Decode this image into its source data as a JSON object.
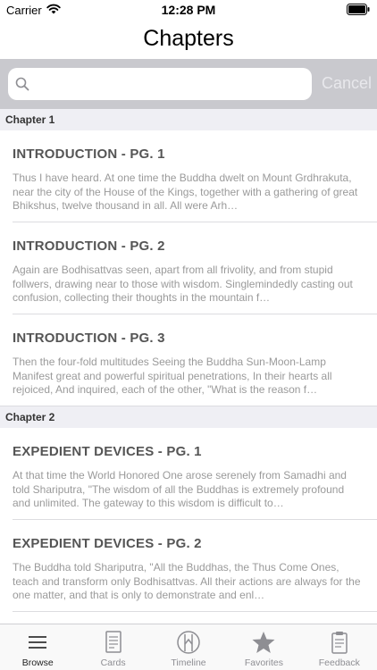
{
  "status": {
    "carrier": "Carrier",
    "time": "12:28 PM"
  },
  "nav": {
    "title": "Chapters"
  },
  "search": {
    "placeholder": "",
    "value": "",
    "cancel_label": "Cancel"
  },
  "sections": [
    {
      "header": "Chapter 1",
      "rows": [
        {
          "title": "INTRODUCTION - PG. 1",
          "excerpt": "Thus I have heard. At one time the Buddha dwelt on Mount Grdhrakuta, near the city of the House of the Kings, together with a gathering of great Bhikshus, twelve thousand in all. All were Arh…"
        },
        {
          "title": "INTRODUCTION - PG. 2",
          "excerpt": "Again are Bodhisattvas seen, apart from all frivolity, and from stupid follwers, drawing near to those with wisdom. Singlemindedly casting out confusion, collecting their thoughts in the mountain f…"
        },
        {
          "title": "INTRODUCTION - PG. 3",
          "excerpt": "Then the four-fold multitudes Seeing the Buddha Sun-Moon-Lamp Manifest great and powerful spiritual penetrations, In their hearts all rejoiced, And inquired, each of the other, \"What is the reason f…"
        }
      ]
    },
    {
      "header": "Chapter 2",
      "rows": [
        {
          "title": "EXPEDIENT DEVICES - PG. 1",
          "excerpt": "At that time the World Honored One arose serenely from Samadhi and told Shariputra, \"The wisdom of all the Buddhas is extremely profound and unlimited. The gateway to this wisdom is difficult to…"
        },
        {
          "title": "EXPEDIENT DEVICES - PG. 2",
          "excerpt": "The Buddha told Shariputra, \"All the Buddhas, the Thus Come Ones, teach and transform only Bodhisattvas. All their actions are always for the one matter, and that is only to demonstrate and enl…"
        }
      ]
    }
  ],
  "tabs": [
    {
      "label": "Browse",
      "icon": "list-icon",
      "active": true
    },
    {
      "label": "Cards",
      "icon": "card-icon",
      "active": false
    },
    {
      "label": "Timeline",
      "icon": "timeline-icon",
      "active": false
    },
    {
      "label": "Favorites",
      "icon": "star-icon",
      "active": false
    },
    {
      "label": "Feedback",
      "icon": "clipboard-icon",
      "active": false
    }
  ],
  "colors": {
    "search_bar_bg": "#c9c9ce",
    "section_header_bg": "#efeff4",
    "title_text": "#555555",
    "excerpt_text": "#9a9a9a",
    "tab_inactive": "#8e8e93",
    "tab_active": "#222222"
  }
}
